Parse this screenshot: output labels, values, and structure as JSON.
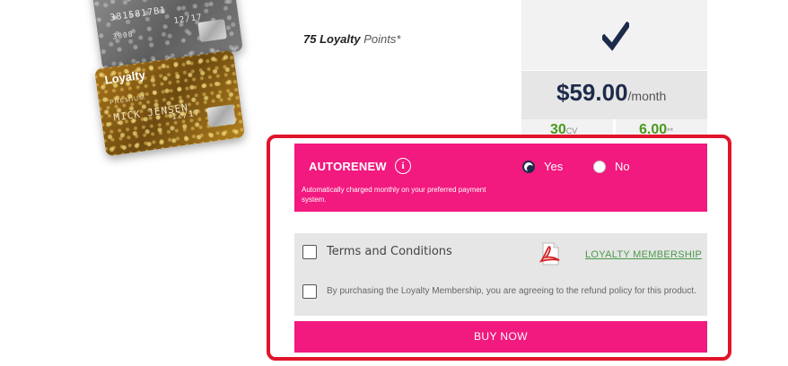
{
  "cards": {
    "silver": {
      "number": "3815817B1",
      "holder_id": "3008",
      "expiry": "12/17"
    },
    "gold": {
      "brand": "Loyalty",
      "tier": "PREMIUM",
      "holder": "MICK JENSEN",
      "expiry": "12/17"
    }
  },
  "points": {
    "amount": "75 Loyalty",
    "suffix": "Points*"
  },
  "pricing": {
    "check_icon": "checkmark-icon",
    "price": "$59.00",
    "period": "/month",
    "stat_left_value": "30",
    "stat_left_unit": "CV",
    "stat_right_value": "6.00",
    "stat_right_unit": "**"
  },
  "autorenew": {
    "title": "AUTORENEW",
    "info_icon": "i",
    "description": "Automatically charged monthly on your preferred payment system.",
    "option_yes": "Yes",
    "option_no": "No",
    "selected": "Yes"
  },
  "terms": {
    "label": "Terms and Conditions",
    "pdf_icon": "pdf-icon",
    "link_label": "LOYALTY MEMBERSHIP",
    "refund_text": "By purchasing the Loyalty Membership, you are agreeing to the refund policy for this product."
  },
  "buy_label": "BUY NOW",
  "colors": {
    "accent": "#f2197f",
    "navy": "#1d2b4a",
    "highlight": "#e0142a",
    "green": "#4a9a1a"
  }
}
